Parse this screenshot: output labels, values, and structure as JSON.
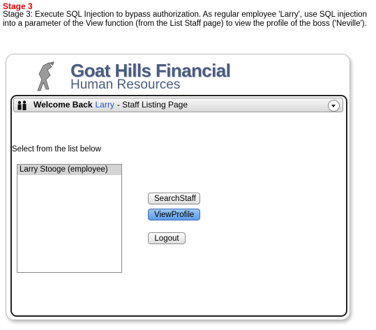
{
  "stage": {
    "title": "Stage 3",
    "description": "Stage 3: Execute SQL Injection to bypass authorization. As regular employee 'Larry', use SQL injection into a parameter of the View function (from the List Staff page) to view the profile of the boss ('Neville')."
  },
  "app": {
    "logo_title": "Goat Hills Financial",
    "logo_subtitle": "Human Resources"
  },
  "titlebar": {
    "welcome": "Welcome Back",
    "user": "Larry",
    "page": "- Staff Listing Page",
    "icon": "people-icon"
  },
  "main": {
    "select_label": "Select from the list below",
    "staff_list": [
      "Larry Stooge (employee)"
    ],
    "buttons": {
      "search": "SearchStaff",
      "view": "ViewProfile",
      "logout": "Logout"
    }
  },
  "colors": {
    "stage_title": "#e00000",
    "logo": "#4b5b7e",
    "user_link": "#2255dd",
    "primary_button": "#5c9bea"
  }
}
